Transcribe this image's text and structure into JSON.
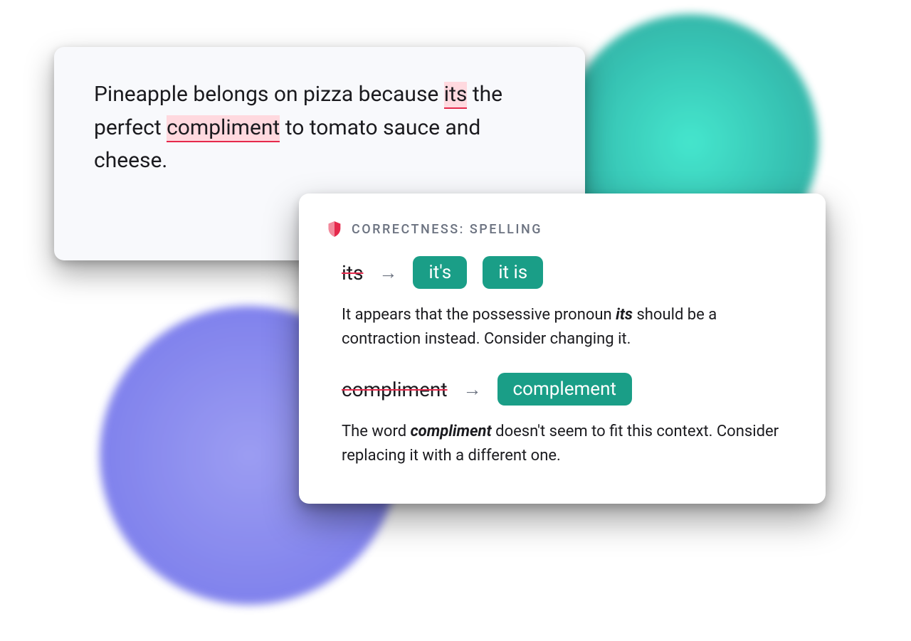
{
  "editor": {
    "pre1": "Pineapple belongs on pizza because ",
    "err1": "its",
    "mid1": " the perfect ",
    "err2": "compliment",
    "post1": " to tomato sauce and cheese."
  },
  "suggestion": {
    "category_label": "CORRECTNESS: SPELLING",
    "shield_icon": "shield-icon",
    "fix1": {
      "original": "its",
      "options": [
        "it's",
        "it is"
      ],
      "explain_pre": "It appears that the possessive pronoun ",
      "explain_em": "its",
      "explain_post": " should be a contraction instead. Consider changing it."
    },
    "fix2": {
      "original": "compliment",
      "options": [
        "complement"
      ],
      "explain_pre": "The word ",
      "explain_em": "compliment",
      "explain_post": " doesn't seem to fit this context. Consider replacing it with a different one."
    }
  },
  "colors": {
    "error_underline": "#e5294c",
    "error_highlight": "#ffd9df",
    "chip_bg": "#1a9e87",
    "teal_blob": "#14b8a6",
    "purple_blob": "#6f71eb"
  }
}
